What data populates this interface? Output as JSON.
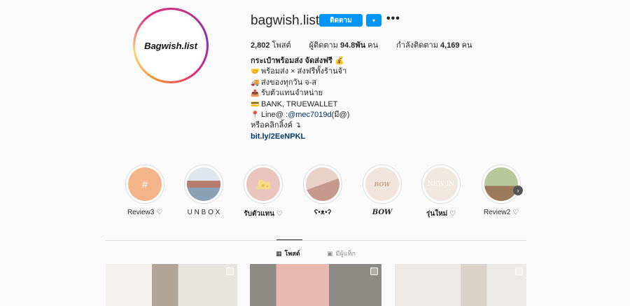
{
  "profile": {
    "avatar_text": "Bagwish.list",
    "username": "bagwish.list",
    "follow_label": "ติดตาม",
    "dropdown_icon": "▾",
    "more_icon": "•••"
  },
  "stats": {
    "posts_count": "2,802",
    "posts_label": "โพสต์",
    "followers_label": "ผู้ติดตาม",
    "followers_count": "94.8พัน",
    "followers_unit": "คน",
    "following_label": "กำลังติดตาม",
    "following_count": "4,169",
    "following_unit": "คน"
  },
  "bio": {
    "title": "กระเป๋าพร้อมส่ง จัดส่งฟรี",
    "title_emoji": "💰",
    "lines": [
      {
        "emoji": "🤝",
        "text": "พร้อมส่ง × ส่งฟรีทั้งร้านจ้า"
      },
      {
        "emoji": "🚚",
        "text": "ส่งของทุกวัน จ-ส"
      },
      {
        "emoji": "📤",
        "text": "รับตัวแทนจำหน่าย"
      },
      {
        "emoji": "💳",
        "text": "BANK, TRUEWALLET"
      },
      {
        "emoji": "📍",
        "text_prefix": "Line@ : ",
        "mention": "@mec7019d",
        "text_suffix": " (มี@)"
      },
      {
        "emoji": "",
        "text": "หรือคลิกลิ้งค์ ↴"
      }
    ],
    "link": "bit.ly/2EeNPKL"
  },
  "highlights": [
    {
      "label": "Review3 ♡",
      "color": "#f4b48a",
      "icon": "#"
    },
    {
      "label": "U N B O X",
      "color": "#8aa0b4",
      "icon": ""
    },
    {
      "label": "รับตัวแทน ♡",
      "color": "#e9c5bd",
      "icon": "cheese-icon"
    },
    {
      "label": "ʕ•ᴥ•ʔ",
      "color": "#d7b8ad",
      "icon": ""
    },
    {
      "label": "BOW",
      "color": "#f1e4dc",
      "icon": "BOW"
    },
    {
      "label": "รุ่นใหม่ ♡",
      "color": "#efe8e0",
      "icon": "NEW IN"
    },
    {
      "label": "Review2 ♡",
      "color": "#b9c89c",
      "icon": ""
    }
  ],
  "tabs": {
    "posts": {
      "label": "โพสต์",
      "icon": "grid-icon"
    },
    "tagged": {
      "label": "มีผู้แท็ก",
      "icon": "tagged-icon"
    }
  },
  "posts": [
    {
      "color": "#e7e2dd"
    },
    {
      "color": "#8d8b85"
    },
    {
      "color": "#e9e7e4"
    }
  ]
}
